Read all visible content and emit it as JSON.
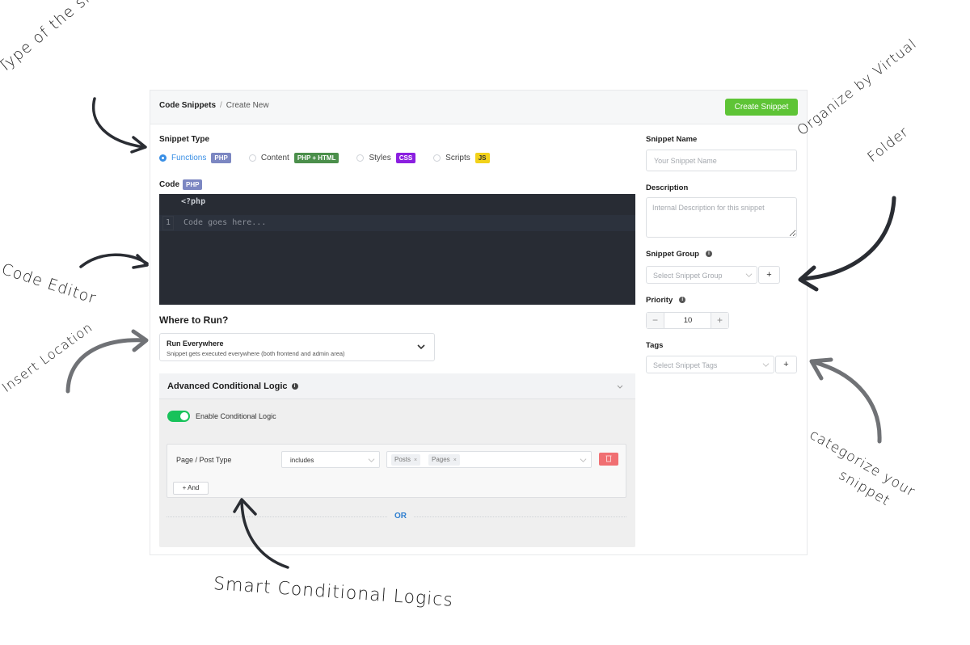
{
  "header": {
    "breadcrumb_root": "Code Snippets",
    "breadcrumb_separator": "/",
    "breadcrumb_current": "Create New",
    "create_button": "Create Snippet"
  },
  "snippet_type": {
    "label": "Snippet Type",
    "options": [
      {
        "label": "Functions",
        "badge": "PHP",
        "badge_color": "#7c87c2",
        "selected": true
      },
      {
        "label": "Content",
        "badge": "PHP + HTML",
        "badge_color": "#4b8f4b",
        "selected": false
      },
      {
        "label": "Styles",
        "badge": "CSS",
        "badge_color": "#8b1fe0",
        "selected": false
      },
      {
        "label": "Scripts",
        "badge": "JS",
        "badge_color": "#f2d21a",
        "selected": false
      }
    ]
  },
  "code": {
    "label": "Code",
    "badge": "PHP",
    "php_open_tag": "<?php",
    "line_number": "1",
    "placeholder": "Code goes here..."
  },
  "where_to_run": {
    "label": "Where to Run?",
    "selected_title": "Run Everywhere",
    "selected_description": "Snippet gets executed everywhere (both frontend and admin area)"
  },
  "advanced": {
    "title": "Advanced Conditional Logic",
    "info_icon": "i",
    "toggle_label": "Enable Conditional Logic",
    "toggle_on": true,
    "condition": {
      "field": "Page / Post Type",
      "operator": "includes",
      "values": [
        "Posts",
        "Pages"
      ],
      "tag_remove": "×"
    },
    "and_button": "+ And",
    "or_label": "OR"
  },
  "sidebar": {
    "name_label": "Snippet Name",
    "name_placeholder": "Your Snippet Name",
    "description_label": "Description",
    "description_placeholder": "Internal Description for this snippet",
    "group_label": "Snippet Group",
    "group_placeholder": "Select Snippet Group",
    "group_add": "+",
    "priority_label": "Priority",
    "priority_value": "10",
    "priority_minus": "−",
    "priority_plus": "+",
    "tags_label": "Tags",
    "tags_placeholder": "Select Snippet Tags",
    "tags_add": "+"
  },
  "annotations": {
    "type": "Type of the snippet",
    "editor": "Code Editor",
    "location": "Insert Location",
    "folder_line1": "Organize by Virtual",
    "folder_line2": "Folder",
    "categorize_line1": "categorize your",
    "categorize_line2": "snippet",
    "conditional": "Smart Conditional Logics"
  },
  "colors": {
    "primary_blue": "#3a8fe5",
    "create_green": "#5ec436",
    "toggle_green": "#18c25a",
    "delete_red": "#f06f72",
    "editor_bg": "#282c34"
  }
}
